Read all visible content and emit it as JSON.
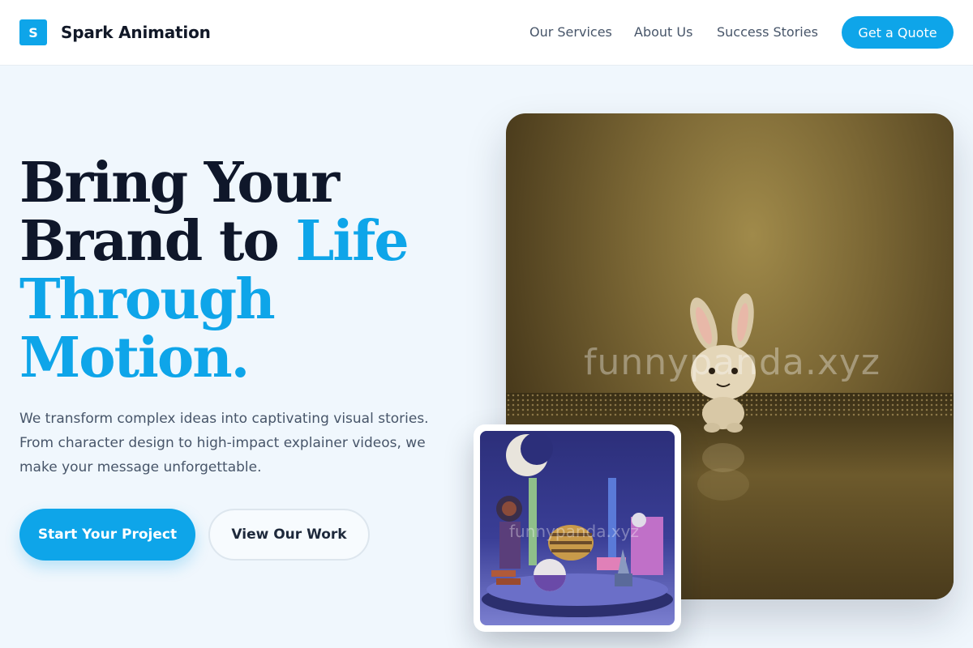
{
  "header": {
    "logo_letter": "S",
    "brand": "Spark Animation",
    "nav": [
      "Our Services",
      "About Us",
      "Success Stories"
    ],
    "cta": "Get a Quote"
  },
  "hero": {
    "headline_line1": "Bring Your",
    "headline_line2_a": "Brand to ",
    "headline_line2_b": "Life",
    "headline_line3": "Through",
    "headline_line4": "Motion.",
    "subtext": "We transform complex ideas into captivating visual stories. From character design to high-impact explainer videos, we make your message unforgettable.",
    "primary_button": "Start Your Project",
    "secondary_button": "View Our Work"
  },
  "images": {
    "main_watermark": "funnypanda.xyz",
    "inset_watermark": "funnypanda.xyz"
  },
  "colors": {
    "accent": "#0ea5e9",
    "heading": "#0f172a",
    "body_text": "#475569",
    "background": "#f0f7fd"
  }
}
